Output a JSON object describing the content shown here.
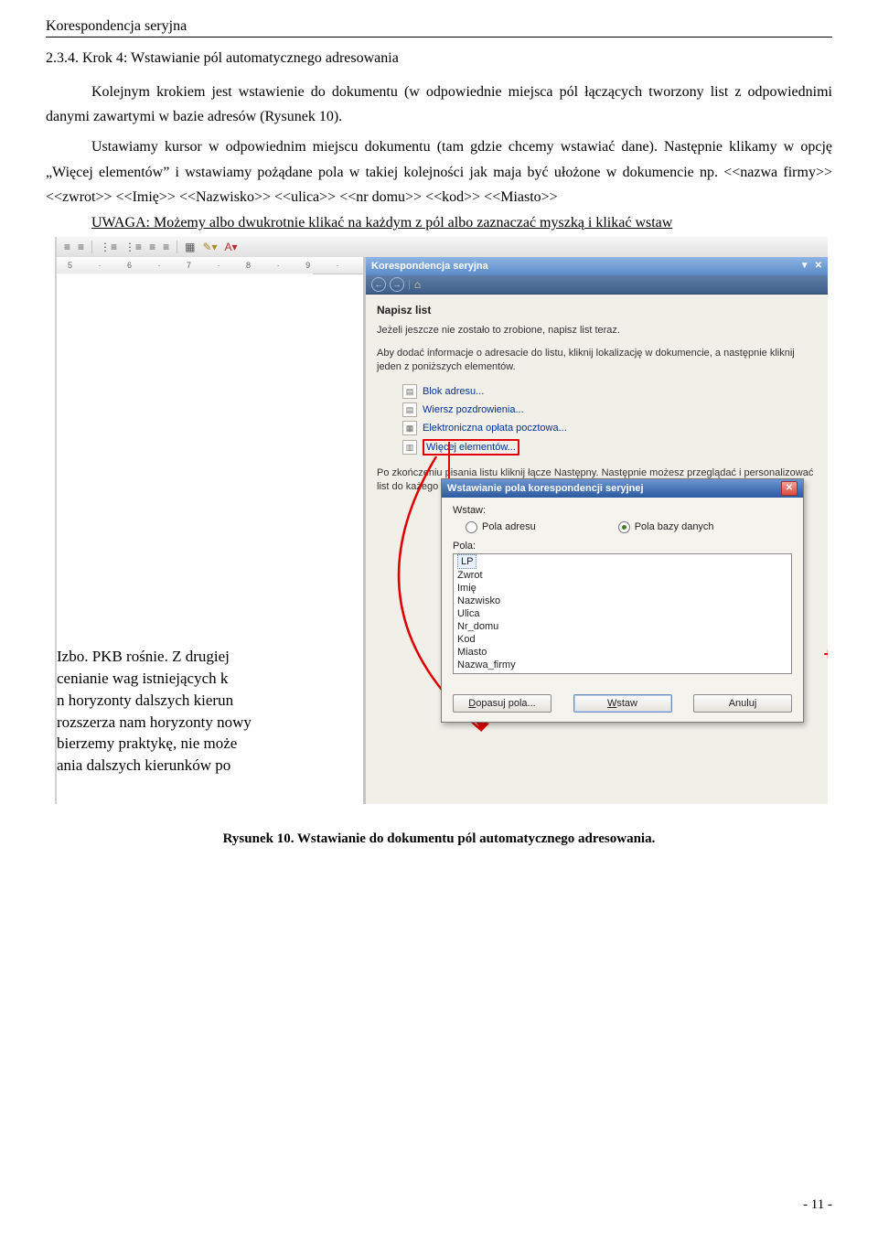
{
  "header": "Korespondencja seryjna",
  "section": "2.3.4.  Krok 4: Wstawianie pól automatycznego adresowania",
  "para1": "Kolejnym krokiem jest wstawienie do dokumentu (w odpowiednie miejsca pól łączących tworzony list z odpowiednimi danymi zawartymi w bazie adresów (Rysunek 10).",
  "para2": "Ustawiamy kursor w odpowiednim miejscu dokumentu (tam gdzie chcemy wstawiać dane). Następnie klikamy w opcję „Więcej elementów” i wstawiamy pożądane pola w takiej kolejności jak maja być ułożone w dokumencie    np.  <<nazwa firmy>>  <<zwrot>>  <<Imię>>  <<Nazwisko>>  <<ulica>>  <<nr domu>> <<kod>> <<Miasto>>",
  "uwaga": "UWAGA: Możemy albo dwukrotnie klikać na każdym z pól albo zaznaczać myszką i klikać wstaw",
  "ruler": [
    "5",
    "·",
    "6",
    "·",
    "7",
    "·",
    "8",
    "·",
    "9",
    "·"
  ],
  "taskpane": {
    "title": "Korespondencja seryjna",
    "stepHead": "Napisz list",
    "p1": "Jeżeli jeszcze nie zostało to zrobione, napisz list teraz.",
    "p2": "Aby dodać informacje o adresacie do listu, kliknij lokalizację w dokumencie, a następnie kliknij jeden z poniższych elementów.",
    "opt1": "Blok adresu...",
    "opt2": "Wiersz pozdrowienia...",
    "opt3": "Elektroniczna opłata pocztowa...",
    "opt4": "Więcej elementów...",
    "p3a": "Po z",
    "p3b": "kończeniu pisania listu kliknij łącze Następny. Następnie możesz przeglądać i personalizować list do każ",
    "p3c": "ego adresata."
  },
  "dialog": {
    "title": "Wstawianie pola korespondencji seryjnej",
    "insertLbl": "Wstaw:",
    "radio1": "Pola adresu",
    "radio2": "Pola bazy danych",
    "fieldsLbl": "Pola:",
    "fields": [
      "LP",
      "Zwrot",
      "Imię",
      "Nazwisko",
      "Ulica",
      "Nr_domu",
      "Kod",
      "Miasto",
      "Nazwa_firmy"
    ],
    "btnMatch": "Dopasuj pola...",
    "btnInsert": "Wstaw",
    "btnCancel": "Anuluj"
  },
  "docSnippet": " Izbo. PKB rośnie. Z drugiej\n cenianie wag istniejących k\nn horyzonty dalszych kierun\nrozszerza nam horyzonty nowy\nbierzemy praktykę, nie może\nania dalszych kierunków po",
  "caption": "Rysunek 10. Wstawianie do dokumentu pól automatycznego adresowania.",
  "pageNum": "- 11 -"
}
